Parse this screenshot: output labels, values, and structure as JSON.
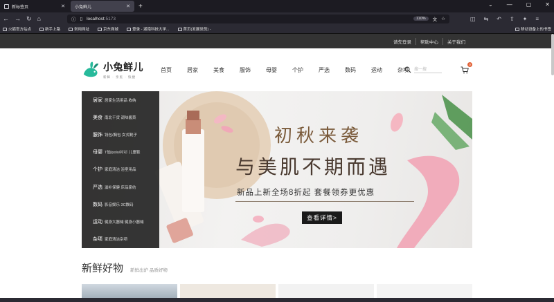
{
  "browser": {
    "tabs": [
      {
        "title": "新标签页",
        "active": false
      },
      {
        "title": "小兔鲜儿",
        "active": true
      }
    ],
    "url_host": "localhost",
    "url_port": ":5173",
    "zoom": "110%",
    "bookmarks": [
      "火狐官方站点",
      "新手上路",
      "常用网址",
      "京东商城",
      "登录 - 湖南科技大学...",
      "首页(发展党员) -"
    ],
    "bookmarks_right": "移动设备上的书签"
  },
  "site": {
    "top_links": [
      "请先登录",
      "帮助中心",
      "关于我们"
    ],
    "logo_name": "小兔鲜儿",
    "logo_slogan": "新鲜 · 亲民 · 快捷",
    "nav": [
      "首页",
      "居家",
      "美食",
      "服饰",
      "母婴",
      "个护",
      "严选",
      "数码",
      "运动",
      "杂项"
    ],
    "search_placeholder": "搜一搜",
    "cart_count": "0",
    "categories": [
      {
        "main": "居家",
        "sub": "居家生活用品 收纳"
      },
      {
        "main": "美食",
        "sub": "南北干货 调味酱菜"
      },
      {
        "main": "服饰",
        "sub": "钱包/胸包 女式靴子"
      },
      {
        "main": "母婴",
        "sub": "T恤/polo/衬衫 儿童鞋"
      },
      {
        "main": "个护",
        "sub": "家庭清洁 浴室用品"
      },
      {
        "main": "严选",
        "sub": "滋补保健 床品家纺"
      },
      {
        "main": "数码",
        "sub": "影音娱乐 3C数码"
      },
      {
        "main": "运动",
        "sub": "健身大器械 健身小器械"
      },
      {
        "main": "杂项",
        "sub": "家庭清洁杂项"
      }
    ],
    "banner": {
      "headline": "初秋来袭",
      "subheadline": "与美肌不期而遇",
      "promo": "新品上新全场8折起 套餐领券更优惠",
      "cta": "查看详情>"
    },
    "section_title": "新鲜好物",
    "section_sub": "新鲜出炉 品质好物"
  }
}
